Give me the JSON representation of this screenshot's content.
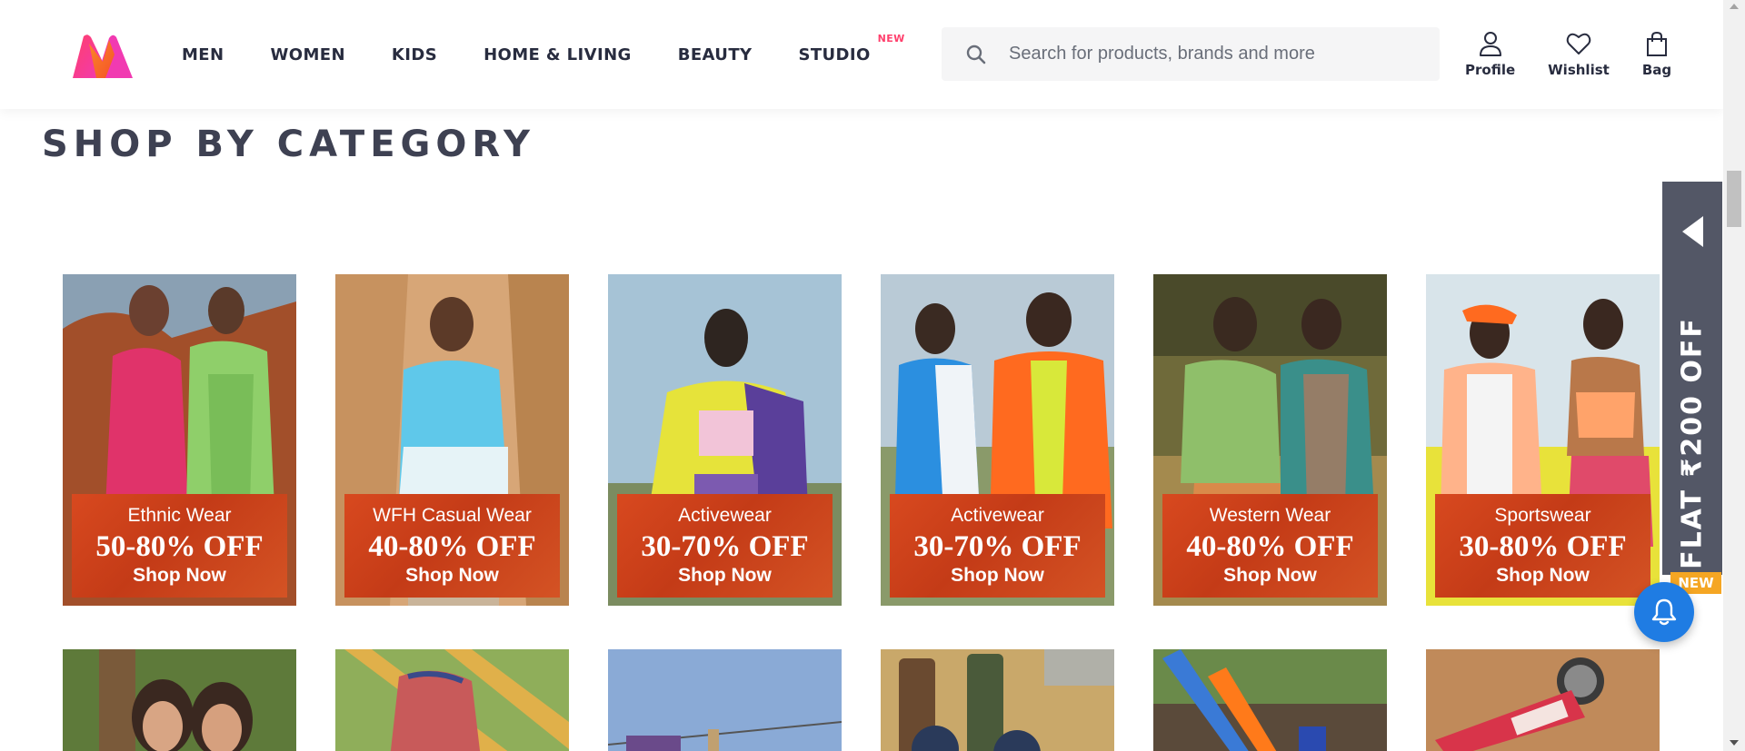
{
  "header": {
    "logo": "myntra-logo",
    "nav": [
      {
        "label": "MEN"
      },
      {
        "label": "WOMEN"
      },
      {
        "label": "KIDS"
      },
      {
        "label": "HOME & LIVING"
      },
      {
        "label": "BEAUTY"
      },
      {
        "label": "STUDIO",
        "badge": "NEW"
      }
    ],
    "search": {
      "placeholder": "Search for products, brands and more",
      "value": "",
      "icon": "search-icon"
    },
    "actions": [
      {
        "label": "Profile",
        "icon": "user-icon"
      },
      {
        "label": "Wishlist",
        "icon": "heart-icon"
      },
      {
        "label": "Bag",
        "icon": "bag-icon"
      }
    ]
  },
  "section": {
    "title": "SHOP BY CATEGORY"
  },
  "tiles": [
    {
      "category": "Ethnic Wear",
      "offer": "50-80% OFF",
      "cta": "Shop Now"
    },
    {
      "category": "WFH Casual Wear",
      "offer": "40-80% OFF",
      "cta": "Shop Now"
    },
    {
      "category": "Activewear",
      "offer": "30-70% OFF",
      "cta": "Shop Now"
    },
    {
      "category": "Activewear",
      "offer": "30-70% OFF",
      "cta": "Shop Now"
    },
    {
      "category": "Western Wear",
      "offer": "40-80% OFF",
      "cta": "Shop Now"
    },
    {
      "category": "Sportswear",
      "offer": "30-80% OFF",
      "cta": "Shop Now"
    }
  ],
  "side_offer": {
    "text": "FLAT ₹200 OFF",
    "badge": "NEW"
  },
  "colors": {
    "brand_pink": "#ff3f6c",
    "banner_orange": "#d0451c",
    "offer_panel": "#535766",
    "bell_blue": "#1f7ce3",
    "badge_yellow": "#f5a623"
  }
}
